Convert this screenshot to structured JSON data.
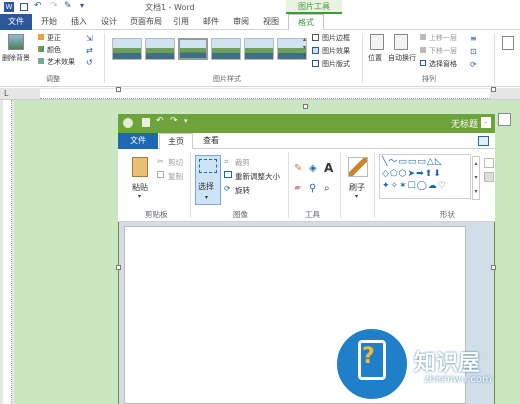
{
  "word": {
    "qat_icons": [
      "word-icon",
      "save-icon",
      "undo-icon",
      "redo-icon",
      "paint-icon",
      "customize-icon"
    ],
    "doc_title": "文档1 - Word",
    "contextual_group": "图片工具",
    "tabs": [
      "文件",
      "开始",
      "插入",
      "设计",
      "页面布局",
      "引用",
      "邮件",
      "审阅",
      "视图",
      "格式"
    ],
    "ribbon": {
      "remove_bg": "删除背景",
      "corrections": "更正",
      "color": "颜色",
      "artistic": "艺术效果",
      "group_adjust": "调整",
      "group_styles": "图片样式",
      "border": "图片边框",
      "effects": "图片效果",
      "layout": "图片版式",
      "position": "位置",
      "wrap": "自动换行",
      "bring_forward": "上移一层",
      "send_backward": "下移一层",
      "selection_pane": "选择窗格",
      "group_arrange": "排列"
    }
  },
  "paint": {
    "title": "无标题",
    "tabs": [
      "文件",
      "主页",
      "查看"
    ],
    "clipboard": {
      "paste": "粘贴",
      "cut": "剪切",
      "copy": "复制",
      "label": "剪贴板"
    },
    "image": {
      "select": "选择",
      "crop": "裁剪",
      "resize": "重新调整大小",
      "rotate": "旋转",
      "label": "图像"
    },
    "tools_label": "工具",
    "brush": "刷子",
    "shapes_label": "形状"
  },
  "watermark": {
    "name": "知识屋",
    "url": "zhishiwu.com"
  },
  "colors": {
    "word_blue": "#2b579a",
    "picture_green": "#3c9a3c",
    "paint_green": "#6ea23a",
    "doc_bg": "#c9e8c2",
    "paint_blue": "#1e67b5"
  }
}
